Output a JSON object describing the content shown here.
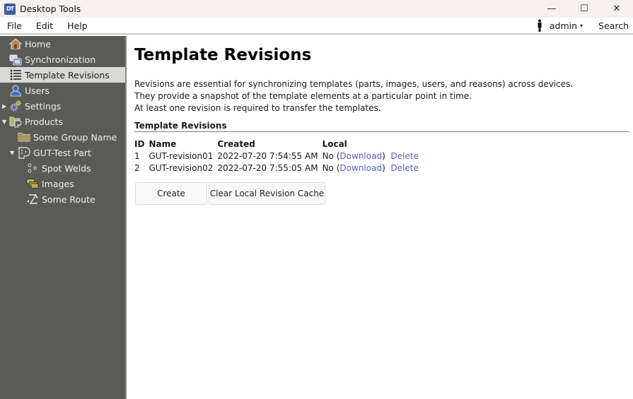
{
  "window": {
    "title": "Desktop Tools",
    "app_icon_text": "DT",
    "controls": {
      "minimize": "—",
      "maximize": "☐",
      "close": "✕"
    }
  },
  "menubar": {
    "items": [
      "File",
      "Edit",
      "Help"
    ],
    "user": "admin",
    "user_caret": "▾",
    "search": "Search"
  },
  "sidebar": {
    "items": [
      {
        "label": "Home",
        "icon": "home-icon"
      },
      {
        "label": "Synchronization",
        "icon": "sync-icon"
      },
      {
        "label": "Template Revisions",
        "icon": "list-icon",
        "active": true
      },
      {
        "label": "Users",
        "icon": "user-icon"
      },
      {
        "label": "Settings",
        "icon": "gear-icon",
        "expander": "▶"
      },
      {
        "label": "Products",
        "icon": "products-icon",
        "expander": "▼"
      },
      {
        "label": "Some Group Name",
        "icon": "folder-icon"
      },
      {
        "label": "GUT-Test Part",
        "icon": "part-icon",
        "expander": "▼"
      },
      {
        "label": "Spot Welds",
        "icon": "spot-welds-icon"
      },
      {
        "label": "Images",
        "icon": "images-icon"
      },
      {
        "label": "Some Route",
        "icon": "route-icon"
      }
    ]
  },
  "main": {
    "title": "Template Revisions",
    "description": [
      "Revisions are essential for synchronizing templates (parts, images, users, and reasons) across devices.",
      "They provide a snapshot of the template elements at a particular point in time.",
      "At least one revision is required to transfer the templates."
    ],
    "section_title": "Template Revisions",
    "table": {
      "headers": [
        "ID",
        "Name",
        "Created",
        "Local"
      ],
      "rows": [
        {
          "id": "1",
          "name": "GUT-revision01",
          "created": "2022-07-20 7:54:55 AM",
          "local": "No",
          "download": "Download",
          "delete": "Delete"
        },
        {
          "id": "2",
          "name": "GUT-revision02",
          "created": "2022-07-20 7:55:05 AM",
          "local": "No",
          "download": "Download",
          "delete": "Delete"
        }
      ]
    },
    "buttons": {
      "create": "Create",
      "clear_cache": "Clear Local Revision Cache"
    }
  }
}
